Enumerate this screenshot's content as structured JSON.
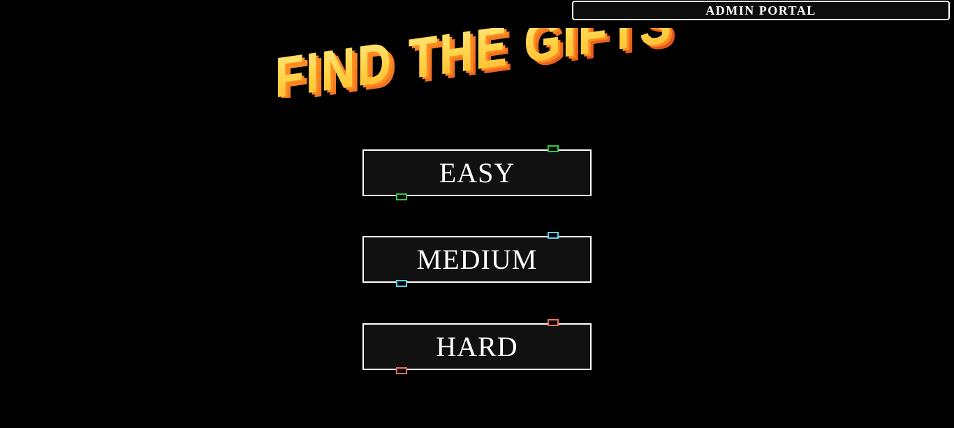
{
  "header": {
    "admin_portal_label": "ADMIN PORTAL"
  },
  "title": {
    "text": "FIND THE GIFTS",
    "colors": {
      "face": "#ffd54a",
      "face_highlight": "#ffe88a",
      "side": "#ff8a1e",
      "shadow": "#e04a1a"
    }
  },
  "difficulty": {
    "buttons": [
      {
        "label": "EASY",
        "accent": "#2ecc40"
      },
      {
        "label": "MEDIUM",
        "accent": "#5bd4f0"
      },
      {
        "label": "HARD",
        "accent": "#f07060"
      }
    ]
  }
}
